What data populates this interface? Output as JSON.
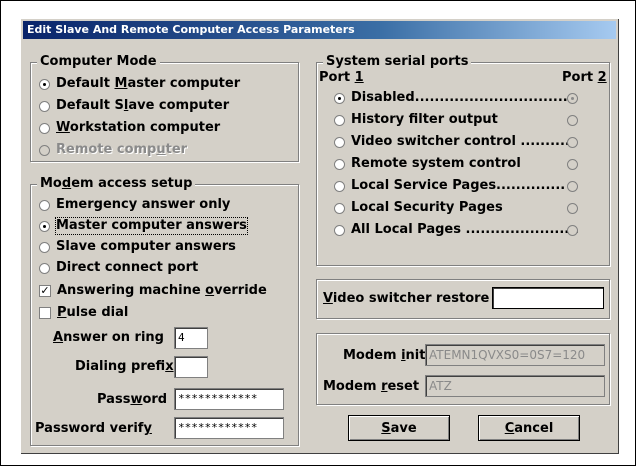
{
  "dialog": {
    "title": "Edit Slave And Remote Computer Access Parameters"
  },
  "computer_mode": {
    "legend": "Computer Mode",
    "options": [
      {
        "pre": "Default ",
        "u": "M",
        "post": "aster computer",
        "selected": true,
        "disabled": false
      },
      {
        "pre": "Default S",
        "u": "l",
        "post": "ave computer",
        "selected": false,
        "disabled": false
      },
      {
        "pre": "",
        "u": "W",
        "post": "orkstation computer",
        "selected": false,
        "disabled": false
      },
      {
        "pre": "Remote comp",
        "u": "u",
        "post": "ter",
        "selected": false,
        "disabled": true
      }
    ]
  },
  "modem_access": {
    "legend_pre": "Mo",
    "legend_u": "d",
    "legend_post": "em access setup",
    "options": [
      {
        "label": "Emergency answer only",
        "selected": false
      },
      {
        "label": "Master computer answers",
        "selected": true
      },
      {
        "label": "Slave computer answers",
        "selected": false
      },
      {
        "label": "Direct connect port",
        "selected": false
      }
    ],
    "answering_machine": {
      "pre": "Answering machine ",
      "u": "o",
      "post": "verride",
      "checked": true
    },
    "pulse_dial": {
      "pre": "",
      "u": "P",
      "post": "ulse dial",
      "checked": false
    },
    "answer_on_ring": {
      "pre": "",
      "u": "A",
      "post": "nswer on ring",
      "value": "4"
    },
    "dialing_prefix": {
      "pre": "Dialing prefi",
      "u": "x",
      "post": "",
      "value": ""
    },
    "password": {
      "pre": "Pass",
      "u": "w",
      "post": "ord",
      "value": "************"
    },
    "password_verify": {
      "pre": "Password verif",
      "u": "y",
      "post": "",
      "value": "************"
    }
  },
  "serial_ports": {
    "legend": "System serial ports",
    "port1_pre": "Port ",
    "port1_u": "1",
    "port2_pre": "Port ",
    "port2_u": "2",
    "options": [
      {
        "label": "Disabled................................",
        "port1": true,
        "port2": true
      },
      {
        "label": "History filter output",
        "port1": false,
        "port2": false
      },
      {
        "label": "Video switcher control ...........",
        "port1": false,
        "port2": false
      },
      {
        "label": "Remote system control",
        "port1": false,
        "port2": false
      },
      {
        "label": "Local Service Pages..............",
        "port1": false,
        "port2": false
      },
      {
        "label": "Local Security Pages",
        "port1": false,
        "port2": false
      },
      {
        "label": "All Local Pages .......................",
        "port1": false,
        "port2": false
      }
    ]
  },
  "video_restore": {
    "pre": "",
    "u": "V",
    "post": "ideo switcher restore",
    "value": ""
  },
  "modem_strings": {
    "init": {
      "pre": "Modem ",
      "u": "i",
      "post": "nit",
      "value": "ATEMN1QVXS0=0S7=120"
    },
    "reset": {
      "pre": "Modem ",
      "u": "r",
      "post": "eset",
      "value": "ATZ"
    }
  },
  "buttons": {
    "save": {
      "pre": "",
      "u": "S",
      "post": "ave"
    },
    "cancel": {
      "pre": "",
      "u": "C",
      "post": "ancel"
    }
  },
  "icons": {
    "radio": "radio-button",
    "check": "checkbox"
  }
}
